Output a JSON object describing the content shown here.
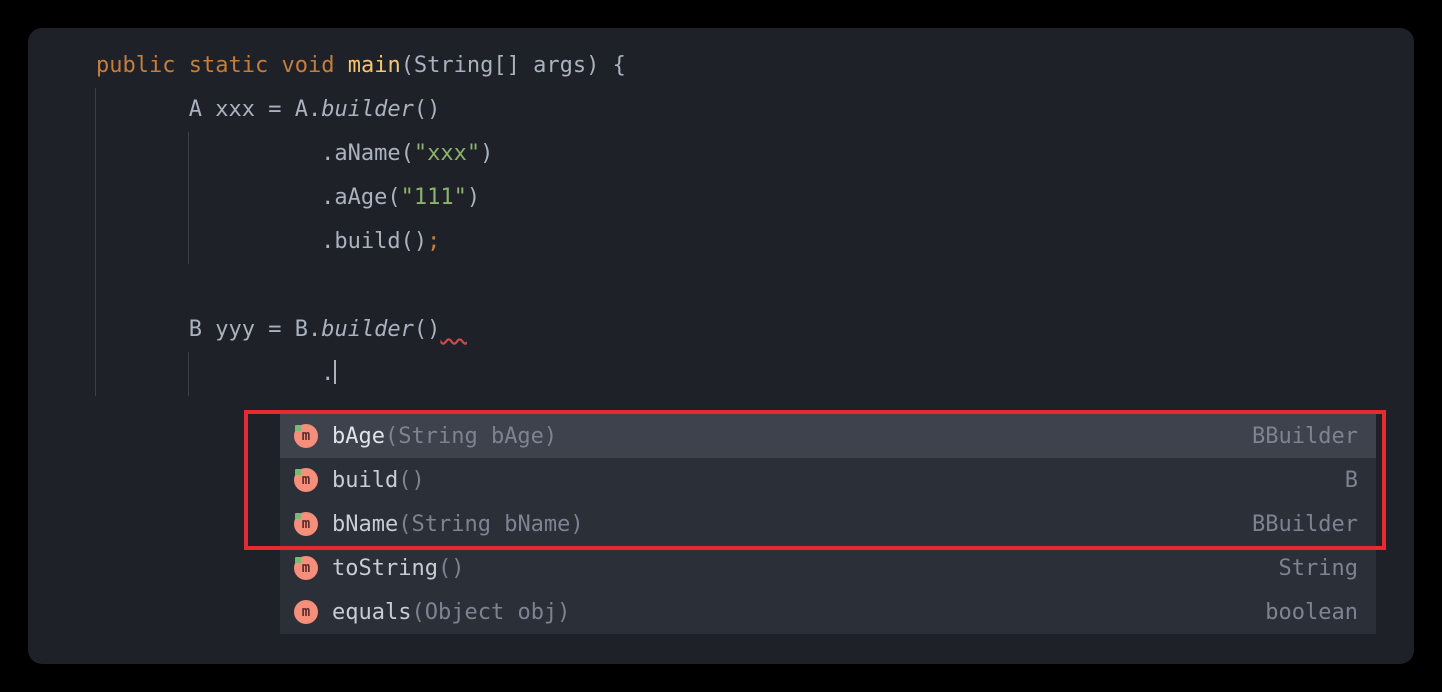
{
  "code": {
    "line1": {
      "kw_public": "public",
      "kw_static": "static",
      "kw_void": "void",
      "method": "main",
      "params": "(String[] args) {"
    },
    "line2": {
      "type_a": "A",
      "var_xxx": " xxx ",
      "eq": "=",
      "type_a2": " A",
      "dot": ".",
      "builder": "builder",
      "parens": "()"
    },
    "line3": {
      "dot": ".",
      "method": "aName",
      "open": "(",
      "str": "\"xxx\"",
      "close": ")"
    },
    "line4": {
      "dot": ".",
      "method": "aAge",
      "open": "(",
      "str": "\"111\"",
      "close": ")"
    },
    "line5": {
      "dot": ".",
      "method": "build",
      "parens": "()",
      "semi": ";"
    },
    "line7": {
      "type_b": "B",
      "var_yyy": " yyy ",
      "eq": "=",
      "type_b2": " B",
      "dot": ".",
      "builder": "builder",
      "parens": "()"
    },
    "line8": {
      "dot": "."
    }
  },
  "completion": {
    "items": [
      {
        "name": "bAge",
        "params": "(String bAge)",
        "return": "BBuilder",
        "selected": true,
        "icon_type": "method"
      },
      {
        "name": "build",
        "params": "()",
        "return": "B",
        "selected": false,
        "icon_type": "method"
      },
      {
        "name": "bName",
        "params": "(String bName)",
        "return": "BBuilder",
        "selected": false,
        "icon_type": "method"
      },
      {
        "name": "toString",
        "params": "()",
        "return": "String",
        "selected": false,
        "icon_type": "method"
      },
      {
        "name": "equals",
        "params": "(Object obj)",
        "return": "boolean",
        "selected": false,
        "icon_type": "plain"
      }
    ],
    "icon_letter": "m"
  }
}
